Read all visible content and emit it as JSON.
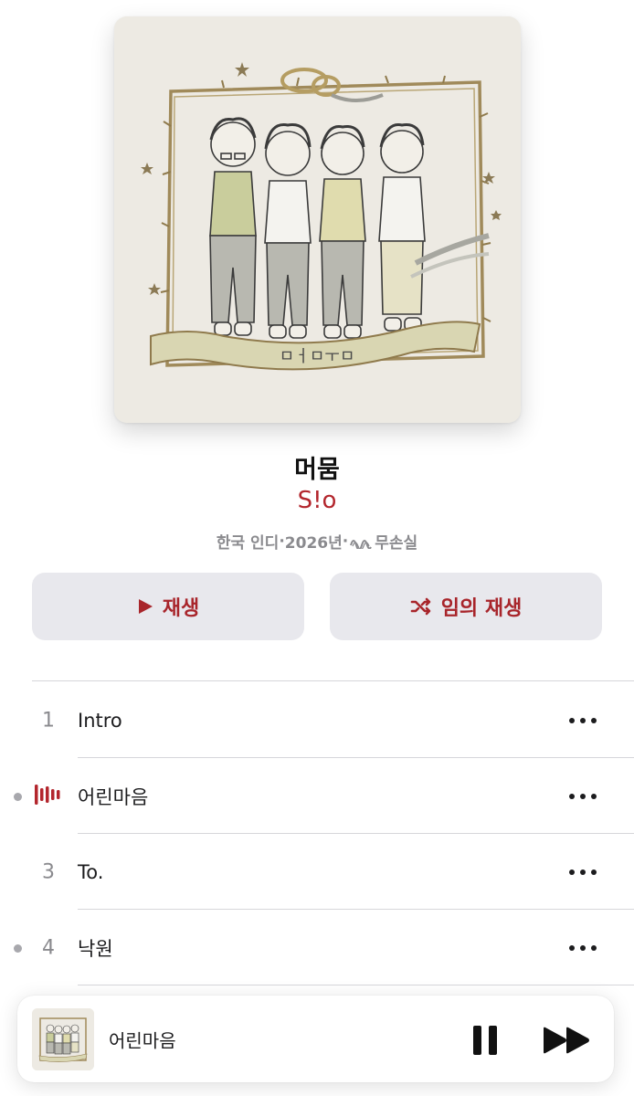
{
  "album": {
    "title": "머뭄",
    "artist": "S!o",
    "meta": {
      "genre": "한국 인디",
      "sep1": " · ",
      "year": "2026년",
      "sep2": " · ",
      "quality": "무손실"
    },
    "art_banner_text": "ㅁㅓㅁㅜㅁ"
  },
  "actions": {
    "play_label": "재생",
    "shuffle_label": "임의 재생"
  },
  "tracks": [
    {
      "number": "1",
      "title": "Intro",
      "playing": false,
      "downloaded": false
    },
    {
      "number": "2",
      "title": "어린마음",
      "playing": true,
      "downloaded": true
    },
    {
      "number": "3",
      "title": "To.",
      "playing": false,
      "downloaded": false
    },
    {
      "number": "4",
      "title": "낙원",
      "playing": false,
      "downloaded": true
    }
  ],
  "now_playing": {
    "title": "어린마음",
    "state": "playing"
  },
  "colors": {
    "accent": "#b3262d",
    "button_bg": "#e8e8ed",
    "secondary_text": "#8a8a8e"
  },
  "icons": {
    "play": "play-icon",
    "shuffle": "shuffle-icon",
    "lossless": "lossless-icon",
    "more": "more-icon",
    "equalizer": "now-playing-equalizer-icon",
    "pause": "pause-icon",
    "next": "next-track-icon"
  }
}
